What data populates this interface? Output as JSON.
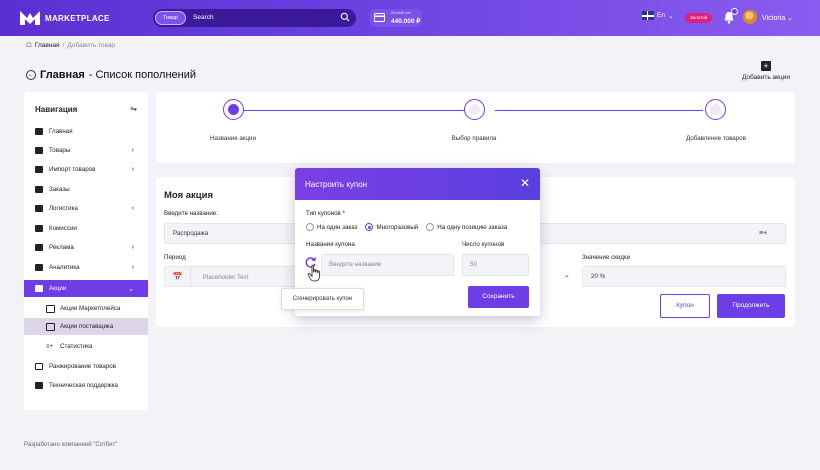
{
  "header": {
    "brand": "MARKETPLACE",
    "search_chip": "Товар",
    "search_text": "Search",
    "balance_label": "Личный счет",
    "balance_value": "440.000 ₽",
    "lang": "En",
    "status_badge": "Золотой",
    "user_name": "Victoria"
  },
  "breadcrumb": {
    "home": "Главная",
    "separator": "/",
    "current": "Добавить товар"
  },
  "page": {
    "title_bold": "Главная",
    "title_rest": "- Список пополнений",
    "add_action_label": "Добавить акции"
  },
  "sidebar": {
    "title": "Навигация",
    "items": [
      {
        "label": "Главная",
        "has_arrow": false
      },
      {
        "label": "Товары",
        "has_arrow": true
      },
      {
        "label": "Импорт товаров",
        "has_arrow": true
      },
      {
        "label": "Заказы",
        "has_arrow": false
      },
      {
        "label": "Логистика",
        "has_arrow": true
      },
      {
        "label": "Комиссии",
        "has_arrow": false
      },
      {
        "label": "Реклама",
        "has_arrow": true
      },
      {
        "label": "Аналитика",
        "has_arrow": true
      },
      {
        "label": "Акции",
        "has_arrow": true,
        "active": true
      }
    ],
    "sub_items": [
      {
        "label": "Акции Маркетплейса"
      },
      {
        "label": "Акции поставщика",
        "selected": true
      },
      {
        "label": "Статистика"
      }
    ],
    "bottom_items": [
      {
        "label": "Ранжирование товаров"
      },
      {
        "label": "Техническая поддержка"
      }
    ]
  },
  "stepper": {
    "steps": [
      {
        "label": "Название акции",
        "active": true
      },
      {
        "label": "Выбор правила",
        "active": false
      },
      {
        "label": "Добавление товаров",
        "active": false
      }
    ]
  },
  "form": {
    "title": "Моя акция",
    "name_label": "Введите название:",
    "name_value": "Распродажа",
    "period_label": "Период",
    "period_placeholder": "Placeholder Text",
    "discount_label": "Значение скидки",
    "discount_value": "20 %",
    "add_icon_text": "≡+",
    "coupon_button": "Купон",
    "continue_button": "Продолжить"
  },
  "modal": {
    "title": "Настроить купон",
    "coupon_type_label": "Тип купонов *",
    "options": [
      {
        "label": "На один заказ",
        "selected": false
      },
      {
        "label": "Многоразовый",
        "selected": true
      },
      {
        "label": "На одну позицию заказа",
        "selected": false
      }
    ],
    "coupon_name_label": "Названия купона",
    "coupon_name_placeholder": "Введите название",
    "coupon_count_label": "Число купонов",
    "coupon_count_value": "50",
    "save_button": "Сохранить",
    "tooltip": "Сгенерировать купон"
  },
  "footer": {
    "text": "Разработано компанией \"Сотбит\""
  },
  "colors": {
    "accent": "#6d3de6",
    "header_start": "#5b2fd0",
    "header_end": "#8a5cf0",
    "badge": "#e0217f"
  }
}
